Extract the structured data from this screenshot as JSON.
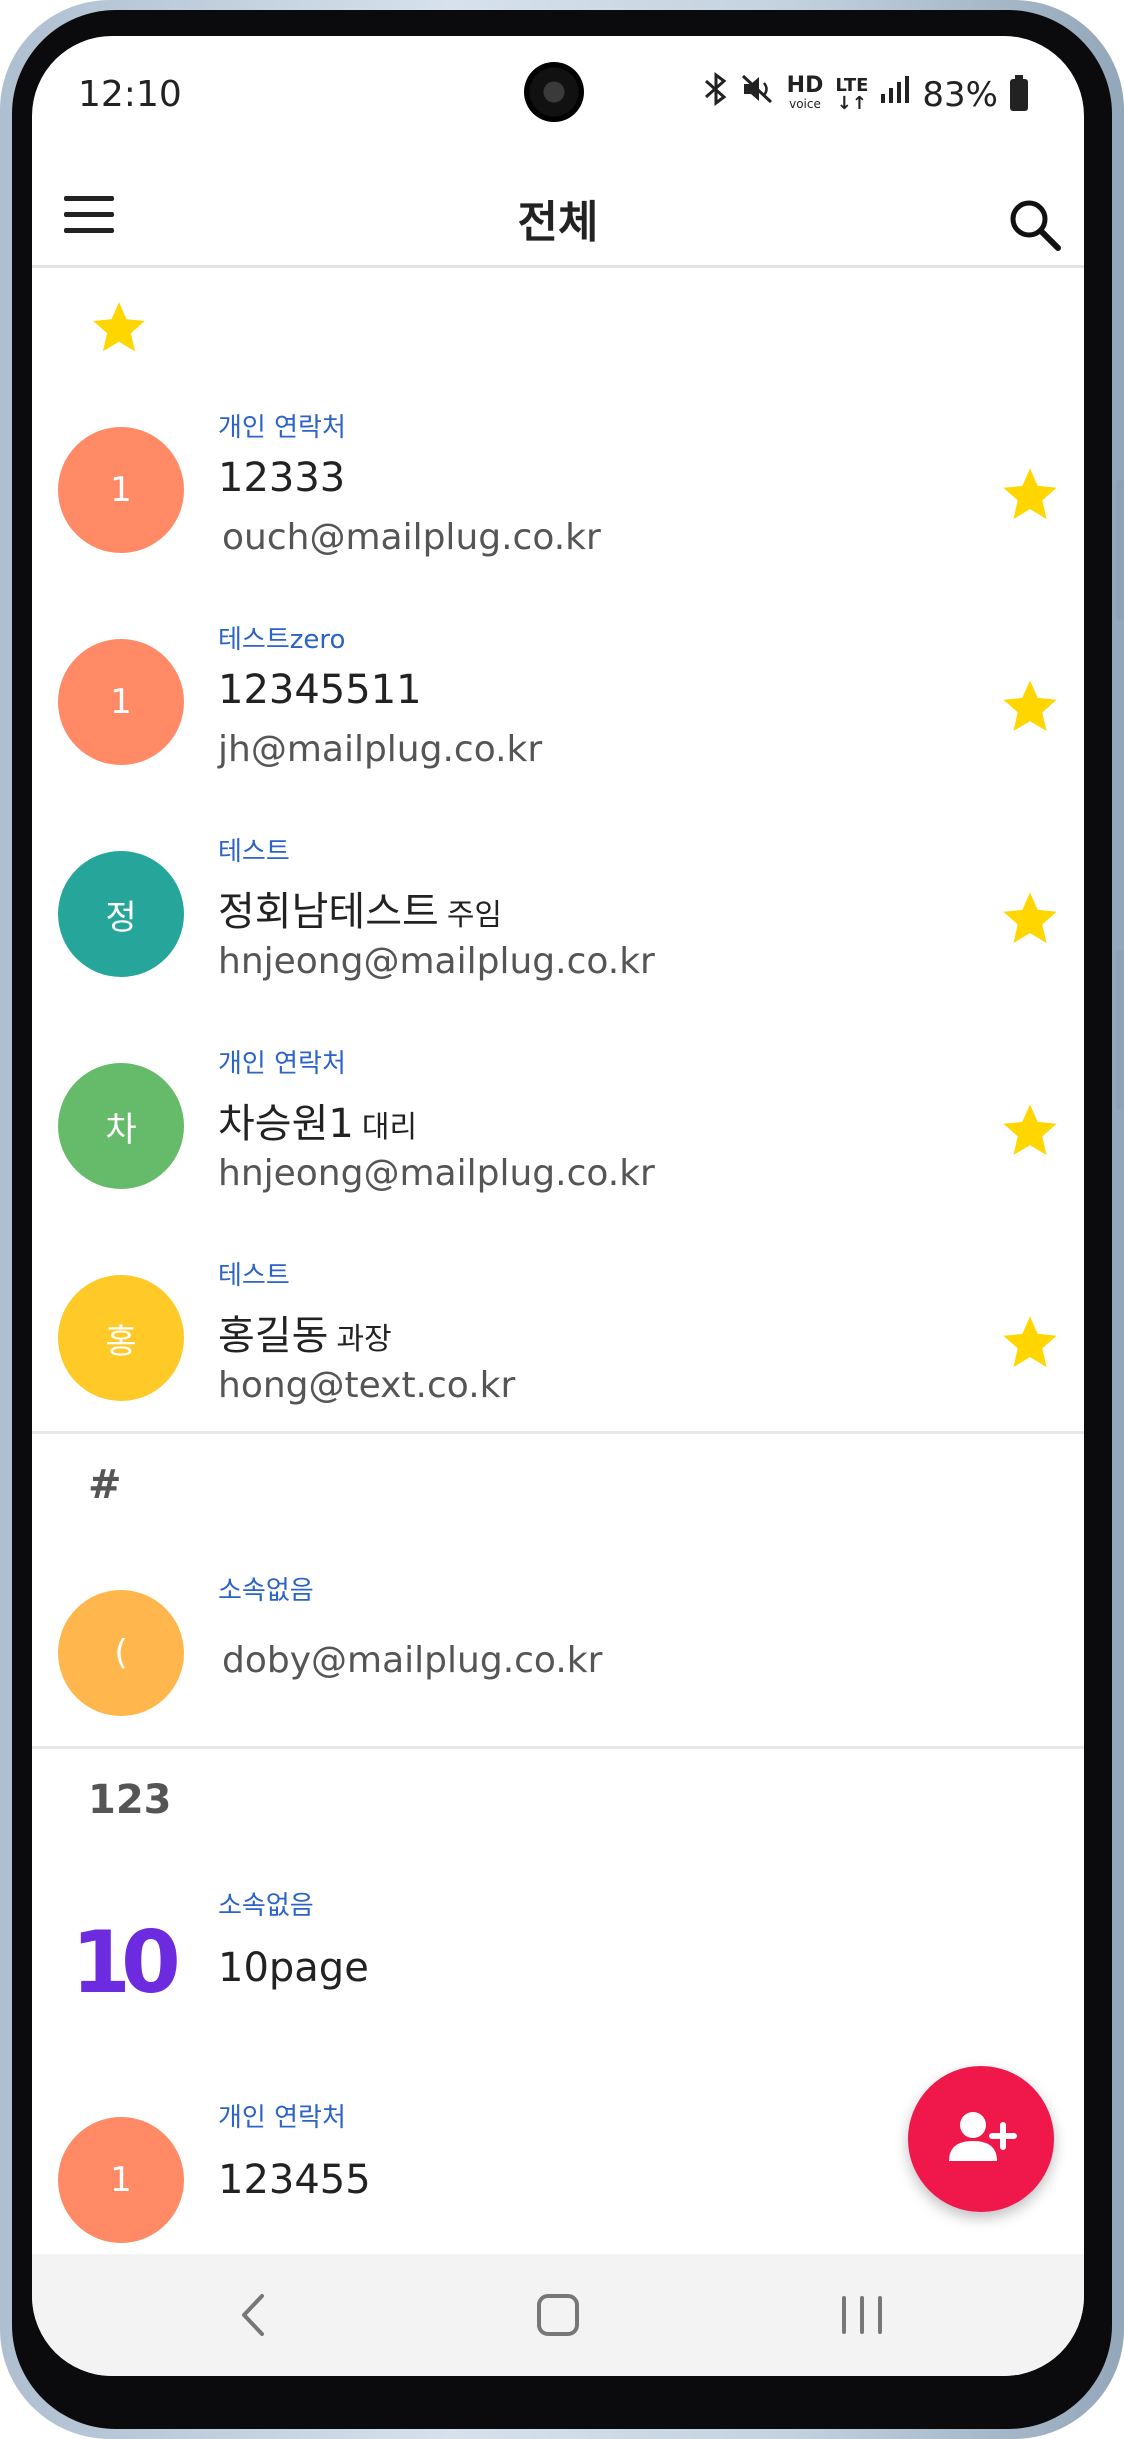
{
  "status_bar": {
    "time": "12:10",
    "icons": [
      "bluetooth-icon",
      "mute-icon",
      "hd-voice-icon",
      "lte-icon",
      "signal-icon"
    ],
    "hd_label": "HD",
    "voice_label": "voice",
    "lte_label": "LTE",
    "battery_percent": "83%"
  },
  "app_bar": {
    "title": "전체",
    "menu_icon": "hamburger-menu-icon",
    "search_icon": "search-icon"
  },
  "sections": {
    "favorites": {
      "header_icon": "star-icon",
      "contacts": [
        {
          "avatar": "1",
          "avatar_color": "#ff8a65",
          "group": "개인 연락처",
          "name": "12333",
          "rank": "",
          "email": "ouch@mailplug.co.kr",
          "starred": true
        },
        {
          "avatar": "1",
          "avatar_color": "#ff8a65",
          "group": "테스트zero",
          "name": "12345511",
          "rank": "",
          "email": "jh@mailplug.co.kr",
          "starred": true
        },
        {
          "avatar": "정",
          "avatar_color": "#26a69a",
          "group": "테스트",
          "name": "정회남테스트",
          "rank": "주임",
          "email": "hnjeong@mailplug.co.kr",
          "starred": true
        },
        {
          "avatar": "차",
          "avatar_color": "#66bb6a",
          "group": "개인 연락처",
          "name": "차승원1",
          "rank": "대리",
          "email": "hnjeong@mailplug.co.kr",
          "starred": true
        },
        {
          "avatar": "홍",
          "avatar_color": "#ffca28",
          "group": "테스트",
          "name": "홍길동",
          "rank": "과장",
          "email": "hong@text.co.kr",
          "starred": true
        }
      ]
    },
    "hash": {
      "header": "#",
      "contacts": [
        {
          "avatar": "(",
          "avatar_color": "#ffb74d",
          "group": "소속없음",
          "email": "doby@mailplug.co.kr"
        }
      ]
    },
    "numeric": {
      "header": "123",
      "contacts": [
        {
          "avatar": "10",
          "avatar_color": "#6d2bdf",
          "group": "소속없음",
          "name": "10page"
        },
        {
          "avatar": "1",
          "avatar_color": "#ff8a65",
          "group": "개인 연락처",
          "name": "123455"
        }
      ]
    }
  },
  "fab": {
    "icon": "add-person-icon",
    "color": "#f0174b"
  },
  "nav_bar": {
    "icons": [
      "back-icon",
      "home-icon",
      "recent-apps-icon"
    ]
  },
  "colors": {
    "group_label": "#2b63c8",
    "star": "#ffd600"
  }
}
